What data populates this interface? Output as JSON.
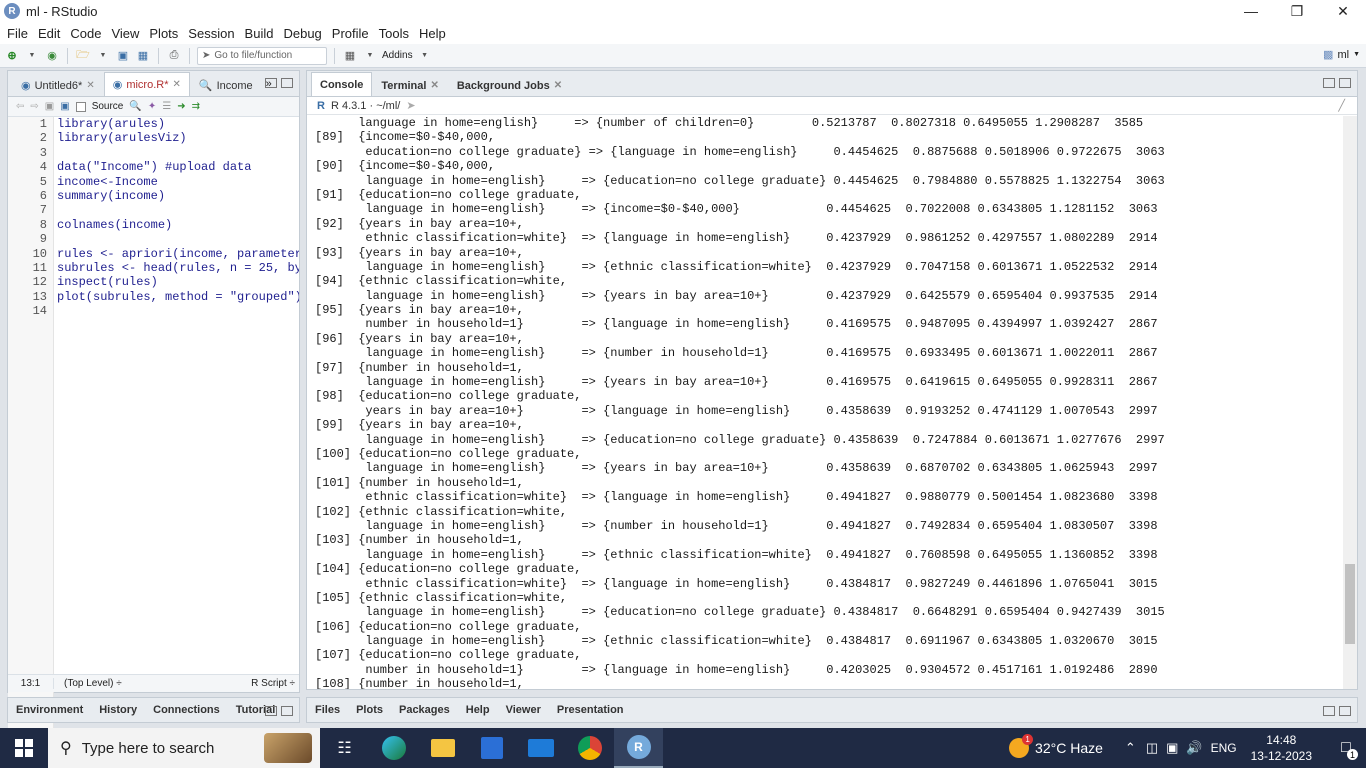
{
  "window": {
    "title": "ml - RStudio",
    "app_letter": "R"
  },
  "menu": [
    "File",
    "Edit",
    "Code",
    "View",
    "Plots",
    "Session",
    "Build",
    "Debug",
    "Profile",
    "Tools",
    "Help"
  ],
  "toolbar": {
    "goto_placeholder": "Go to file/function",
    "addins_label": "Addins",
    "project_label": "ml"
  },
  "source": {
    "tabs": [
      {
        "label": "Untitled6*",
        "active": false
      },
      {
        "label": "micro.R*",
        "active": true
      },
      {
        "label": "Income",
        "active": false
      }
    ],
    "source_label": "Source",
    "line_numbers": [
      "1",
      "2",
      "3",
      "4",
      "5",
      "6",
      "7",
      "8",
      "9",
      "10",
      "11",
      "12",
      "13",
      "14"
    ],
    "lines": [
      "library(arules)",
      "library(arulesViz)",
      "",
      "data(\"Income\") #upload data",
      "income<-Income",
      "summary(income)",
      "",
      "colnames(income)",
      "",
      "rules <- apriori(income, parameter",
      "subrules <- head(rules, n = 25, by",
      "inspect(rules)",
      "plot(subrules, method = \"grouped\")",
      ""
    ],
    "status": {
      "position": "13:1",
      "level": "(Top Level) ÷",
      "filetype": "R Script ÷"
    }
  },
  "console": {
    "tabs": [
      {
        "label": "Console",
        "active": true
      },
      {
        "label": "Terminal",
        "active": false
      },
      {
        "label": "Background Jobs",
        "active": false
      }
    ],
    "r_version": "R 4.3.1 · ~/ml/",
    "output": [
      "      language in home=english}     => {number of children=0}        0.5213787  0.8027318 0.6495055 1.2908287  3585",
      "[89]  {income=$0-$40,000,",
      "       education=no college graduate} => {language in home=english}     0.4454625  0.8875688 0.5018906 0.9722675  3063",
      "[90]  {income=$0-$40,000,",
      "       language in home=english}     => {education=no college graduate} 0.4454625  0.7984880 0.5578825 1.1322754  3063",
      "[91]  {education=no college graduate,",
      "       language in home=english}     => {income=$0-$40,000}            0.4454625  0.7022008 0.6343805 1.1281152  3063",
      "[92]  {years in bay area=10+,",
      "       ethnic classification=white}  => {language in home=english}     0.4237929  0.9861252 0.4297557 1.0802289  2914",
      "[93]  {years in bay area=10+,",
      "       language in home=english}     => {ethnic classification=white}  0.4237929  0.7047158 0.6013671 1.0522532  2914",
      "[94]  {ethnic classification=white,",
      "       language in home=english}     => {years in bay area=10+}        0.4237929  0.6425579 0.6595404 0.9937535  2914",
      "[95]  {years in bay area=10+,",
      "       number in household=1}        => {language in home=english}     0.4169575  0.9487095 0.4394997 1.0392427  2867",
      "[96]  {years in bay area=10+,",
      "       language in home=english}     => {number in household=1}        0.4169575  0.6933495 0.6013671 1.0022011  2867",
      "[97]  {number in household=1,",
      "       language in home=english}     => {years in bay area=10+}        0.4169575  0.6419615 0.6495055 0.9928311  2867",
      "[98]  {education=no college graduate,",
      "       years in bay area=10+}        => {language in home=english}     0.4358639  0.9193252 0.4741129 1.0070543  2997",
      "[99]  {years in bay area=10+,",
      "       language in home=english}     => {education=no college graduate} 0.4358639  0.7247884 0.6013671 1.0277676  2997",
      "[100] {education=no college graduate,",
      "       language in home=english}     => {years in bay area=10+}        0.4358639  0.6870702 0.6343805 1.0625943  2997",
      "[101] {number in household=1,",
      "       ethnic classification=white}  => {language in home=english}     0.4941827  0.9880779 0.5001454 1.0823680  3398",
      "[102] {ethnic classification=white,",
      "       language in home=english}     => {number in household=1}        0.4941827  0.7492834 0.6595404 1.0830507  3398",
      "[103] {number in household=1,",
      "       language in home=english}     => {ethnic classification=white}  0.4941827  0.7608598 0.6495055 1.1360852  3398",
      "[104] {education=no college graduate,",
      "       ethnic classification=white}  => {language in home=english}     0.4384817  0.9827249 0.4461896 1.0765041  3015",
      "[105] {ethnic classification=white,",
      "       language in home=english}     => {education=no college graduate} 0.4384817  0.6648291 0.6595404 0.9427439  3015",
      "[106] {education=no college graduate,",
      "       language in home=english}     => {ethnic classification=white}  0.4384817  0.6911967 0.6343805 1.0320670  3015",
      "[107] {education=no college graduate,",
      "       number in household=1}        => {language in home=english}     0.4203025  0.9304572 0.4517161 1.0192486  2890",
      "[108] {number in household=1,"
    ]
  },
  "env_tabs": [
    "Environment",
    "History",
    "Connections",
    "Tutorial"
  ],
  "files_tabs": [
    "Files",
    "Plots",
    "Packages",
    "Help",
    "Viewer",
    "Presentation"
  ],
  "taskbar": {
    "search_placeholder": "Type here to search",
    "weather": "32°C  Haze",
    "weather_badge": "1",
    "lang": "ENG",
    "time": "14:48",
    "date": "13-12-2023",
    "notif_count": "1"
  },
  "colors": {
    "accent": "#3a6ea5",
    "taskbar": "#1f2a44"
  }
}
